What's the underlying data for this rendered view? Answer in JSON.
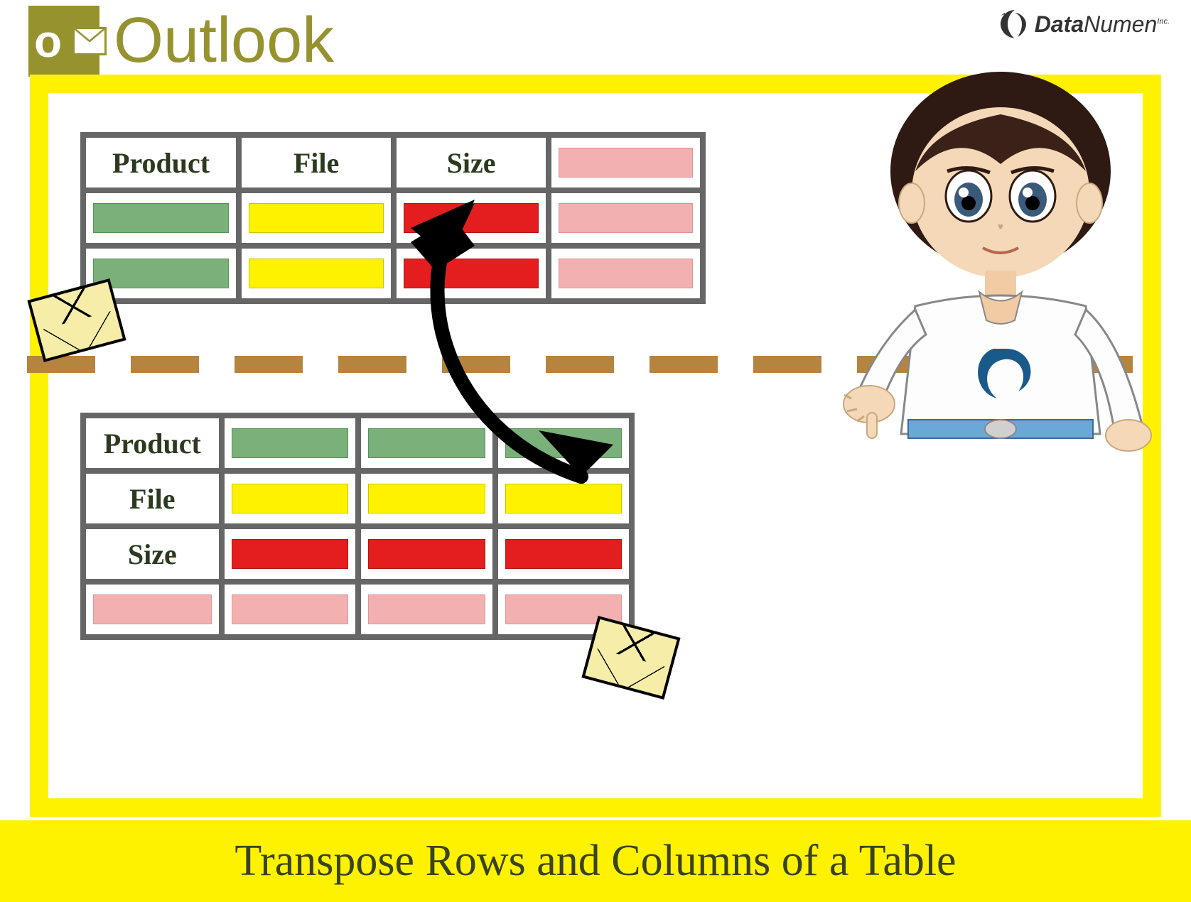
{
  "header": {
    "outlook_text": "Outlook",
    "datanumen_data": "Data",
    "datanumen_numen": "Numen",
    "datanumen_inc": "Inc."
  },
  "table_top": {
    "headers": [
      "Product",
      "File",
      "Size"
    ],
    "colors": {
      "col1": "green",
      "col2": "yellow",
      "col3": "red",
      "col4": "pink"
    }
  },
  "table_bottom": {
    "row_headers": [
      "Product",
      "File",
      "Size"
    ],
    "colors": {
      "row1": "green",
      "row2": "yellow",
      "row3": "red",
      "row4": "pink"
    }
  },
  "caption": "Transpose Rows and Columns of a Table"
}
